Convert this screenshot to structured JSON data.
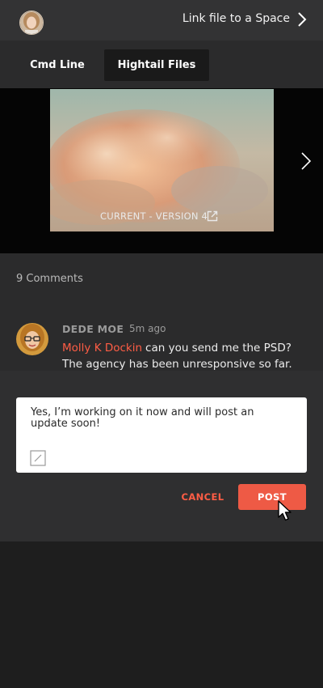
{
  "header": {
    "link_label": "Link file to a Space"
  },
  "tabs": [
    {
      "label": "Cmd Line"
    },
    {
      "label": "Hightail Files"
    }
  ],
  "preview": {
    "version_label": "CURRENT - VERSION 4"
  },
  "comments": {
    "count_label": "9 Comments",
    "items": [
      {
        "author": "DEDE MOE",
        "time": "5m ago",
        "mention": "Molly K Dockin",
        "text": "can you send me the PSD? The agency has been unresponsive so far."
      }
    ]
  },
  "reply": {
    "text": "Yes, I’m working on it now and will post an update soon!",
    "cancel_label": "CANCEL",
    "post_label": "POST"
  },
  "colors": {
    "accent": "#ee5a45",
    "mention": "#ff5d45"
  }
}
